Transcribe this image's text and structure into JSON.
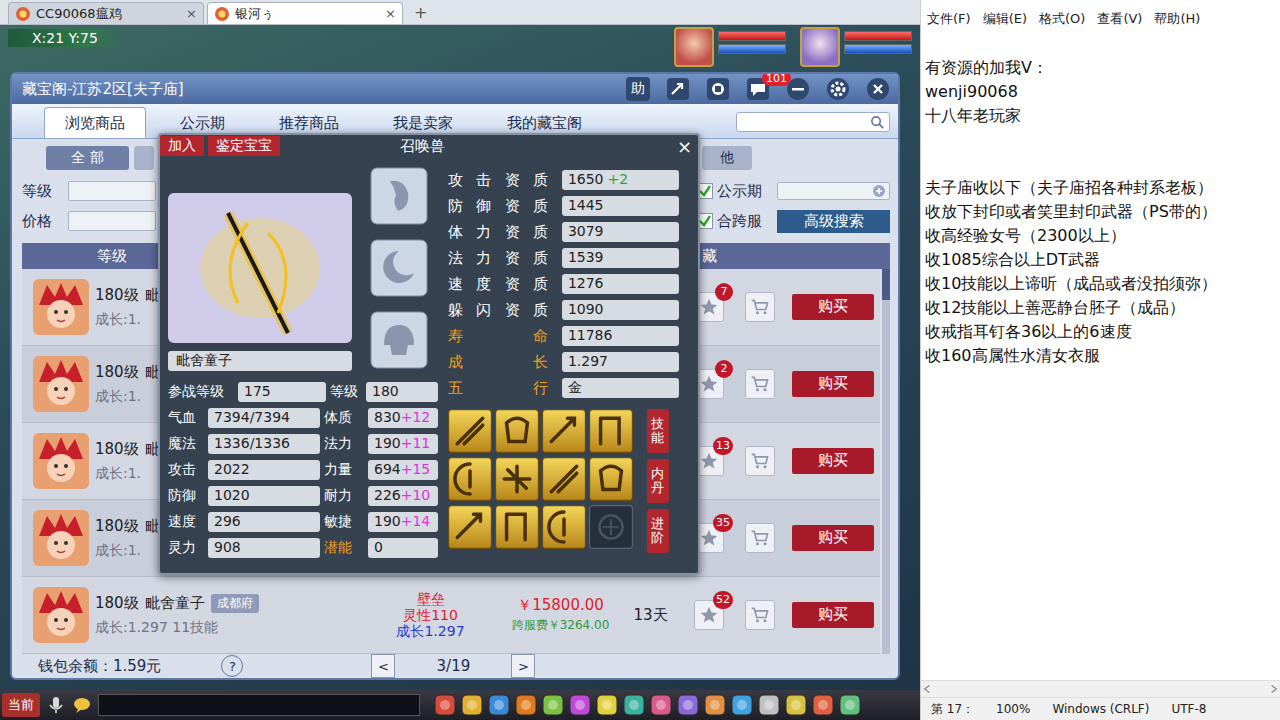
{
  "browser_tabs": {
    "tabs": [
      {
        "label": "CC90068瘟鸡",
        "selected": false,
        "close": "×"
      },
      {
        "label": "银河ぅ",
        "selected": true,
        "close": "×"
      }
    ],
    "new_tab": "+"
  },
  "hud": {
    "coords": "X:21 Y:75",
    "party": [
      {
        "hp": 1,
        "mp": 1
      },
      {
        "hp": 1,
        "mp": 1
      }
    ]
  },
  "dialog": {
    "title": "藏宝阁-江苏2区[夫子庙]",
    "help_button": "助",
    "message_badge": "101",
    "nav_tabs": [
      {
        "label": "浏览商品",
        "selected": true
      },
      {
        "label": "公示期",
        "selected": false
      },
      {
        "label": "推荐商品",
        "selected": false
      },
      {
        "label": "我是卖家",
        "selected": false
      },
      {
        "label": "我的藏宝阁",
        "selected": false
      }
    ],
    "filter_buttons": [
      {
        "label": "全 部",
        "selected": true
      },
      {
        "label": "",
        "selected": false
      },
      {
        "label": "他",
        "selected": false
      }
    ],
    "criteria": {
      "level_label": "等级",
      "price_label": "价格",
      "public_label": "公示期",
      "public_checked": true,
      "cross_label": "合跨服",
      "cross_checked": true,
      "advanced": "高级搜索"
    },
    "table": {
      "columns": {
        "level": "等级",
        "favorite": "藏"
      },
      "scrollbar": {
        "level": 0.08
      },
      "rows": [
        {
          "level": "180级",
          "name": "毗",
          "server": "",
          "summary": "成长:1.",
          "attrs": [],
          "price": "",
          "fee": "",
          "time": "",
          "favorites": "7",
          "buy": "购买"
        },
        {
          "level": "180级",
          "name": "毗",
          "server": "",
          "summary": "成长:1.",
          "attrs": [],
          "price": "",
          "fee": "",
          "time": "",
          "favorites": "2",
          "buy": "购买"
        },
        {
          "level": "180级",
          "name": "毗",
          "server": "",
          "summary": "成长:1.",
          "attrs": [],
          "price": "",
          "fee": "",
          "time": "",
          "favorites": "13",
          "buy": "购买"
        },
        {
          "level": "180级",
          "name": "毗",
          "server": "",
          "summary": "成长:1.",
          "attrs": [],
          "price": "",
          "fee": "",
          "time": "",
          "favorites": "35",
          "buy": "购买"
        },
        {
          "level": "180级",
          "name": "毗舍童子",
          "server": "成都府",
          "summary": "成长:1.297 11技能",
          "attrs": [
            {
              "text": "壁垒",
              "color": "#e0202a"
            },
            {
              "text": "灵性110",
              "color": "#e0202a"
            },
            {
              "text": "成长1.297",
              "color": "#2040d0"
            }
          ],
          "price": "￥15800.00",
          "fee": "跨服费￥3264.00",
          "time": "13天",
          "favorites": "52",
          "buy": "购买"
        }
      ]
    },
    "wallet": "钱包余额：1.59元",
    "help": "?",
    "pager": {
      "prev": "<",
      "page": "3/19",
      "next": ">"
    }
  },
  "pet_card": {
    "tabs": [
      "加入",
      "鉴定宝宝"
    ],
    "title": "召唤兽",
    "close": "×",
    "name": "毗舍童子",
    "stats": [
      [
        {
          "label": "参战等级",
          "value": "175",
          "bonus": "",
          "highlight": false
        },
        {
          "label": "等级",
          "value": "180",
          "bonus": "",
          "highlight": false
        }
      ],
      [
        {
          "label": "气血",
          "value": "7394/7394",
          "bonus": "",
          "highlight": false
        },
        {
          "label": "体质",
          "value": "830",
          "bonus": "+12",
          "highlight": false
        }
      ],
      [
        {
          "label": "魔法",
          "value": "1336/1336",
          "bonus": "",
          "highlight": false
        },
        {
          "label": "法力",
          "value": "190",
          "bonus": "+11",
          "highlight": false
        }
      ],
      [
        {
          "label": "攻击",
          "value": "2022",
          "bonus": "",
          "highlight": false
        },
        {
          "label": "力量",
          "value": "694",
          "bonus": "+15",
          "highlight": false
        }
      ],
      [
        {
          "label": "防御",
          "value": "1020",
          "bonus": "",
          "highlight": false
        },
        {
          "label": "耐力",
          "value": "226",
          "bonus": "+10",
          "highlight": false
        }
      ],
      [
        {
          "label": "速度",
          "value": "296",
          "bonus": "",
          "highlight": false
        },
        {
          "label": "敏捷",
          "value": "190",
          "bonus": "+14",
          "highlight": false
        }
      ],
      [
        {
          "label": "灵力",
          "value": "908",
          "bonus": "",
          "highlight": false
        },
        {
          "label": "潜能",
          "value": "0",
          "bonus": "",
          "highlight": true
        }
      ]
    ],
    "qualities": [
      {
        "label": "攻击资质",
        "value": "1650",
        "bonus": "+2",
        "highlight": false
      },
      {
        "label": "防御资质",
        "value": "1445",
        "bonus": "",
        "highlight": false
      },
      {
        "label": "体力资质",
        "value": "3079",
        "bonus": "",
        "highlight": false
      },
      {
        "label": "法力资质",
        "value": "1539",
        "bonus": "",
        "highlight": false
      },
      {
        "label": "速度资质",
        "value": "1276",
        "bonus": "",
        "highlight": false
      },
      {
        "label": "躲闪资质",
        "value": "1090",
        "bonus": "",
        "highlight": false
      },
      {
        "label": "寿命",
        "value": "11786",
        "bonus": "",
        "highlight": true
      },
      {
        "label": "成长",
        "value": "1.297",
        "bonus": "",
        "highlight": true
      },
      {
        "label": "五行",
        "value": "金",
        "bonus": "",
        "highlight": true
      }
    ],
    "skills": [
      {
        "empty": false
      },
      {
        "empty": false
      },
      {
        "empty": false
      },
      {
        "empty": false
      },
      {
        "empty": false
      },
      {
        "empty": false
      },
      {
        "empty": false
      },
      {
        "empty": false
      },
      {
        "empty": false
      },
      {
        "empty": false
      },
      {
        "empty": false
      },
      {
        "empty": true
      }
    ],
    "side_buttons": [
      "技能",
      "内丹",
      "进阶"
    ]
  },
  "toolbar": {
    "channel": "当前"
  },
  "notepad": {
    "menu": [
      "文件(F)",
      "编辑(E)",
      "格式(O)",
      "查看(V)",
      "帮助(H)"
    ],
    "lines": [
      "有资源的加我V：",
      "wenji90068",
      "十八年老玩家",
      "",
      "",
      "夫子庙收以下（夫子庙招各种封系老板）",
      "收放下封印或者笑里封印武器（PS带的）",
      "收高经验女号（2300以上）",
      "收1085综合以上DT武器",
      "收10技能以上谛听（成品或者没拍须弥）",
      "收12技能以上善恶静台胚子（成品）",
      "收戒指耳钉各36以上的6速度",
      "收160高属性水清女衣服"
    ],
    "status": [
      "第 17：",
      "100%",
      "Windows (CRLF)",
      "UTF-8"
    ]
  }
}
